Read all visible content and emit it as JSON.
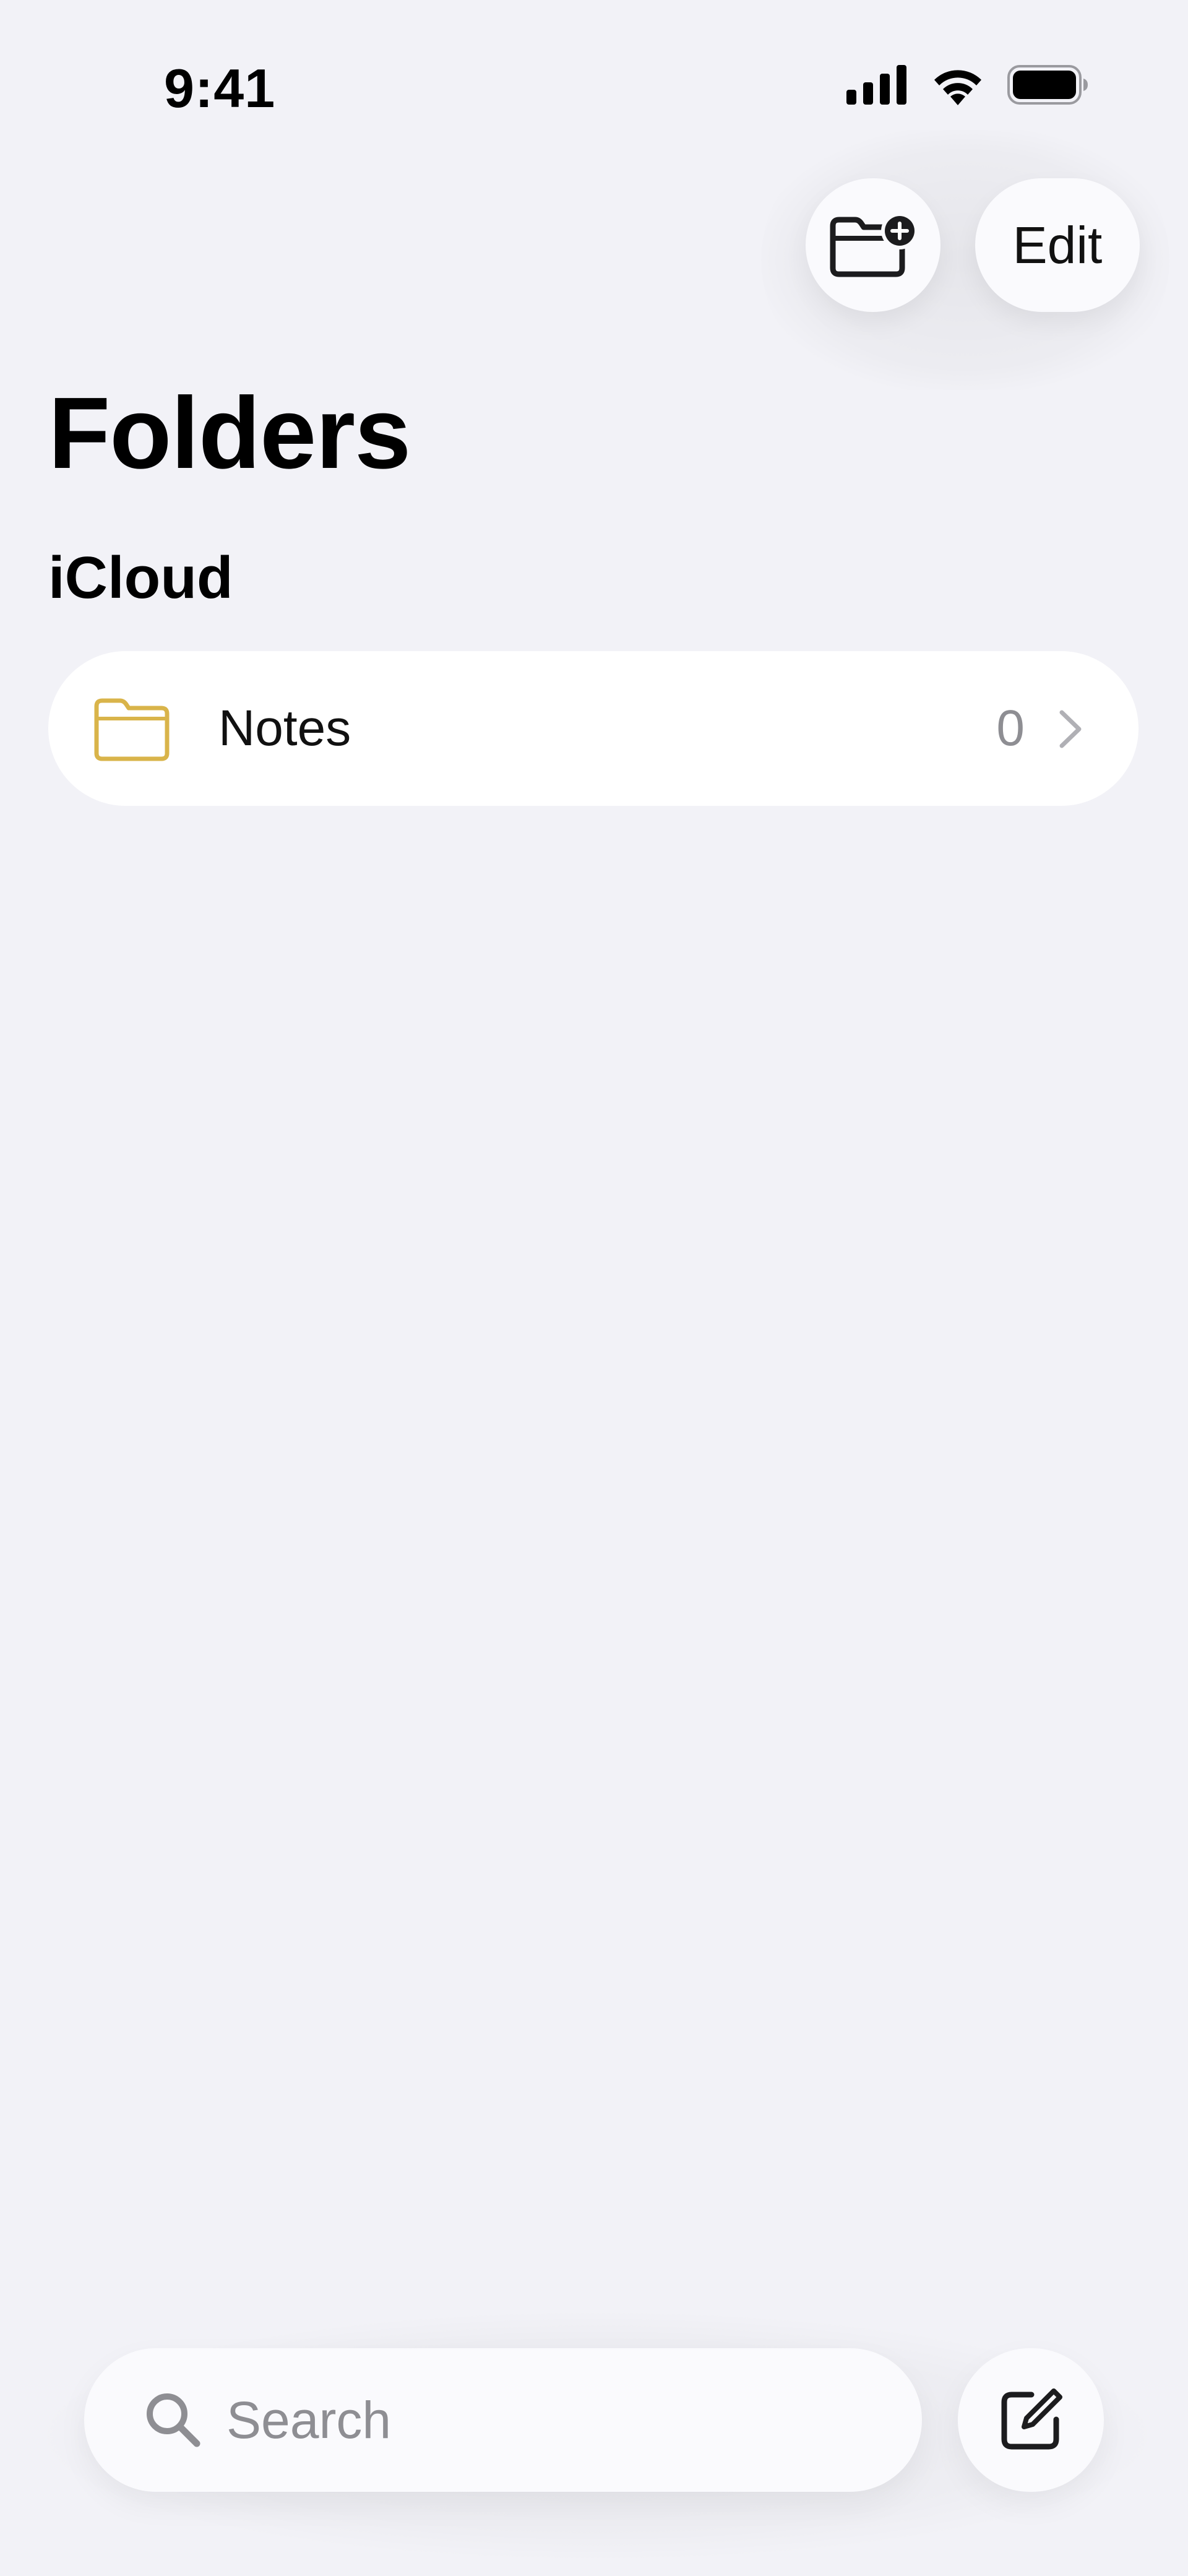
{
  "status_bar": {
    "time": "9:41",
    "icons": [
      "cellular-signal-icon",
      "wifi-icon",
      "battery-icon"
    ]
  },
  "toolbar": {
    "new_folder_icon": "folder-plus-icon",
    "edit_label": "Edit"
  },
  "page": {
    "title": "Folders"
  },
  "sections": [
    {
      "title": "iCloud",
      "folders": [
        {
          "name": "Notes",
          "count": "0",
          "icon": "folder-icon"
        }
      ]
    }
  ],
  "bottom_bar": {
    "search_placeholder": "Search",
    "compose_icon": "compose-icon"
  },
  "colors": {
    "background": "#f2f2f7",
    "folder_accent": "#d9b44a",
    "secondary_text": "#8e8e93"
  }
}
